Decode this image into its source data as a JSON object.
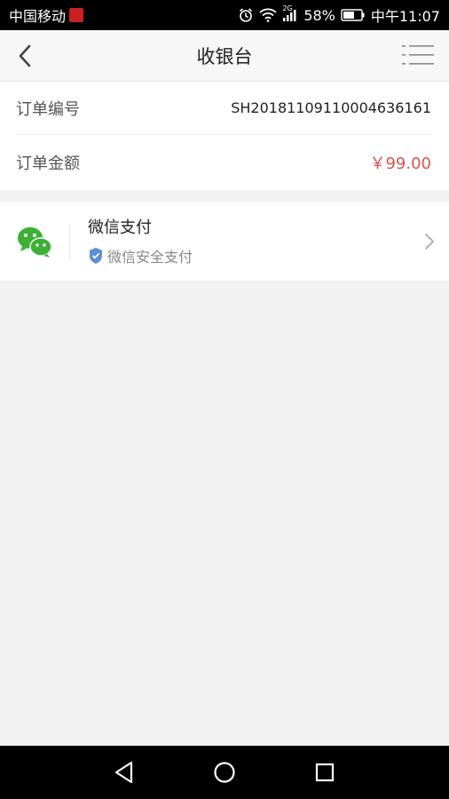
{
  "status_bar": {
    "carrier": "中国移动",
    "network": "2G",
    "battery": "58%",
    "time": "中午11:07"
  },
  "header": {
    "title": "收银台",
    "back_icon": "chevron-left-icon",
    "menu_icon": "list-menu-icon"
  },
  "order": {
    "number_label": "订单编号",
    "number_value": "SH20181109110004636161",
    "amount_label": "订单金额",
    "amount_value": "￥99.00"
  },
  "payment": {
    "method_title": "微信支付",
    "method_subtitle": "微信安全支付",
    "icon": "wechat-icon",
    "shield_icon": "shield-check-icon",
    "arrow_icon": "chevron-right-icon"
  },
  "colors": {
    "amount": "#d9534f",
    "wechat_green": "#3cb034",
    "shield_blue": "#5b8fd6"
  }
}
